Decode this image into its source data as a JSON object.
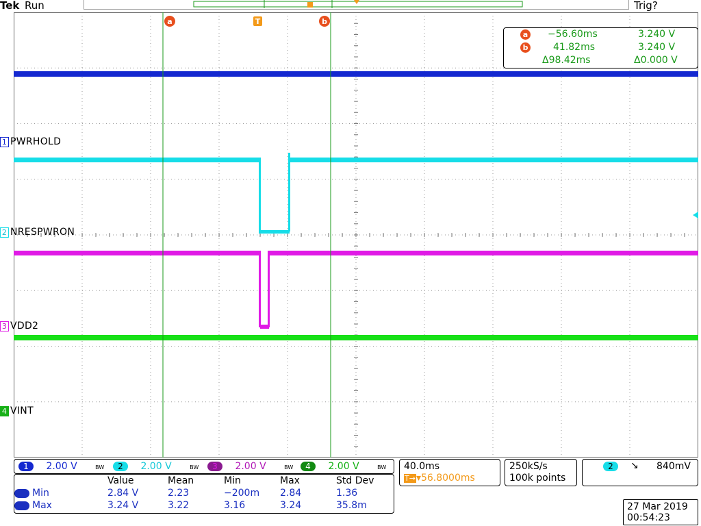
{
  "header": {
    "brand": "Tek",
    "run_state": "Run",
    "trig_state": "Trig?"
  },
  "colors": {
    "ch1": "#1428d0",
    "ch2": "#16dde8",
    "ch3": "#e01ae6",
    "ch4": "#17e017",
    "cursor": "#1a9a1a",
    "trigger": "#f39a1a",
    "marker": "#e8501e"
  },
  "markers": {
    "a": "a",
    "b": "b",
    "t": "T"
  },
  "channels": [
    {
      "num": "1",
      "label": "PWRHOLD"
    },
    {
      "num": "2",
      "label": "NRESPWRON"
    },
    {
      "num": "3",
      "label": "VDD2"
    },
    {
      "num": "4",
      "label": "VINT"
    }
  ],
  "cursor_readout": {
    "a_time": "−56.60ms",
    "a_volt": "3.240 V",
    "b_time": "41.82ms",
    "b_volt": "3.240 V",
    "delta_time": "Δ98.42ms",
    "delta_volt": "Δ0.000 V"
  },
  "vertical": [
    {
      "num": "1",
      "scale": "2.00 V",
      "bw": "BW"
    },
    {
      "num": "2",
      "scale": "2.00 V",
      "bw": "BW"
    },
    {
      "num": "3",
      "scale": "2.00 V",
      "bw": "BW"
    },
    {
      "num": "4",
      "scale": "2.00 V",
      "bw": "BW"
    }
  ],
  "horizontal": {
    "scale": "40.0ms",
    "trigger_pos": "▾56.8000ms",
    "trig_glyph": "T→"
  },
  "acquisition": {
    "rate": "250kS/s",
    "points": "100k points"
  },
  "trigger": {
    "source": "2",
    "slope": "↘",
    "level": "840mV"
  },
  "measurements": {
    "headers": [
      "Value",
      "Mean",
      "Min",
      "Max",
      "Std Dev"
    ],
    "rows": [
      {
        "label": "Min",
        "ch": "1",
        "values": [
          "2.84 V",
          "2.23",
          "−200m",
          "2.84",
          "1.36"
        ]
      },
      {
        "label": "Max",
        "ch": "1",
        "values": [
          "3.24 V",
          "3.22",
          "3.16",
          "3.24",
          "35.8m"
        ]
      }
    ]
  },
  "datetime": {
    "date": "27 Mar 2019",
    "time": "00:54:23"
  }
}
